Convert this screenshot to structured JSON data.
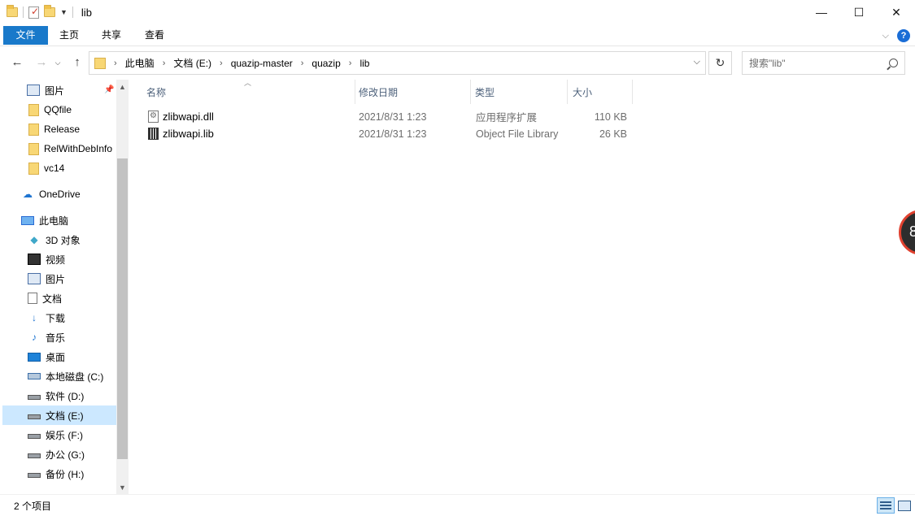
{
  "window": {
    "title": "lib",
    "controls": {
      "minimize": "—",
      "maximize": "☐",
      "close": "✕"
    }
  },
  "ribbon": {
    "tabs": [
      "文件",
      "主页",
      "共享",
      "查看"
    ],
    "help": "?"
  },
  "address": {
    "crumbs": [
      "此电脑",
      "文档 (E:)",
      "quazip-master",
      "quazip",
      "lib"
    ],
    "search_placeholder": "搜索\"lib\""
  },
  "nav_pane": {
    "items": [
      {
        "label": "图片",
        "icon": "pictures-icon",
        "pinned": true
      },
      {
        "label": "QQfile",
        "icon": "folder-icon"
      },
      {
        "label": "Release",
        "icon": "folder-icon"
      },
      {
        "label": "RelWithDebInfo",
        "icon": "folder-icon"
      },
      {
        "label": "vc14",
        "icon": "folder-icon"
      },
      {
        "label": "OneDrive",
        "icon": "onedrive-icon"
      },
      {
        "label": "此电脑",
        "icon": "this-pc-icon"
      },
      {
        "label": "3D 对象",
        "icon": "3d-objects-icon"
      },
      {
        "label": "视频",
        "icon": "videos-icon"
      },
      {
        "label": "图片",
        "icon": "pictures-icon"
      },
      {
        "label": "文档",
        "icon": "documents-icon"
      },
      {
        "label": "下载",
        "icon": "downloads-icon"
      },
      {
        "label": "音乐",
        "icon": "music-icon"
      },
      {
        "label": "桌面",
        "icon": "desktop-icon"
      },
      {
        "label": "本地磁盘 (C:)",
        "icon": "system-drive-icon"
      },
      {
        "label": "软件 (D:)",
        "icon": "drive-icon"
      },
      {
        "label": "文档 (E:)",
        "icon": "drive-icon",
        "selected": true
      },
      {
        "label": "娱乐 (F:)",
        "icon": "drive-icon"
      },
      {
        "label": "办公 (G:)",
        "icon": "drive-icon"
      },
      {
        "label": "备份 (H:)",
        "icon": "drive-icon"
      }
    ]
  },
  "file_list": {
    "columns": [
      "名称",
      "修改日期",
      "类型",
      "大小"
    ],
    "rows": [
      {
        "name": "zlibwapi.dll",
        "date": "2021/8/31 1:23",
        "type": "应用程序扩展",
        "size": "110 KB",
        "icon": "dll-file-icon"
      },
      {
        "name": "zlibwapi.lib",
        "date": "2021/8/31 1:23",
        "type": "Object File Library",
        "size": "26 KB",
        "icon": "lib-file-icon"
      }
    ]
  },
  "status": {
    "item_count": "2 个项目"
  },
  "overlay": {
    "text": "8"
  }
}
